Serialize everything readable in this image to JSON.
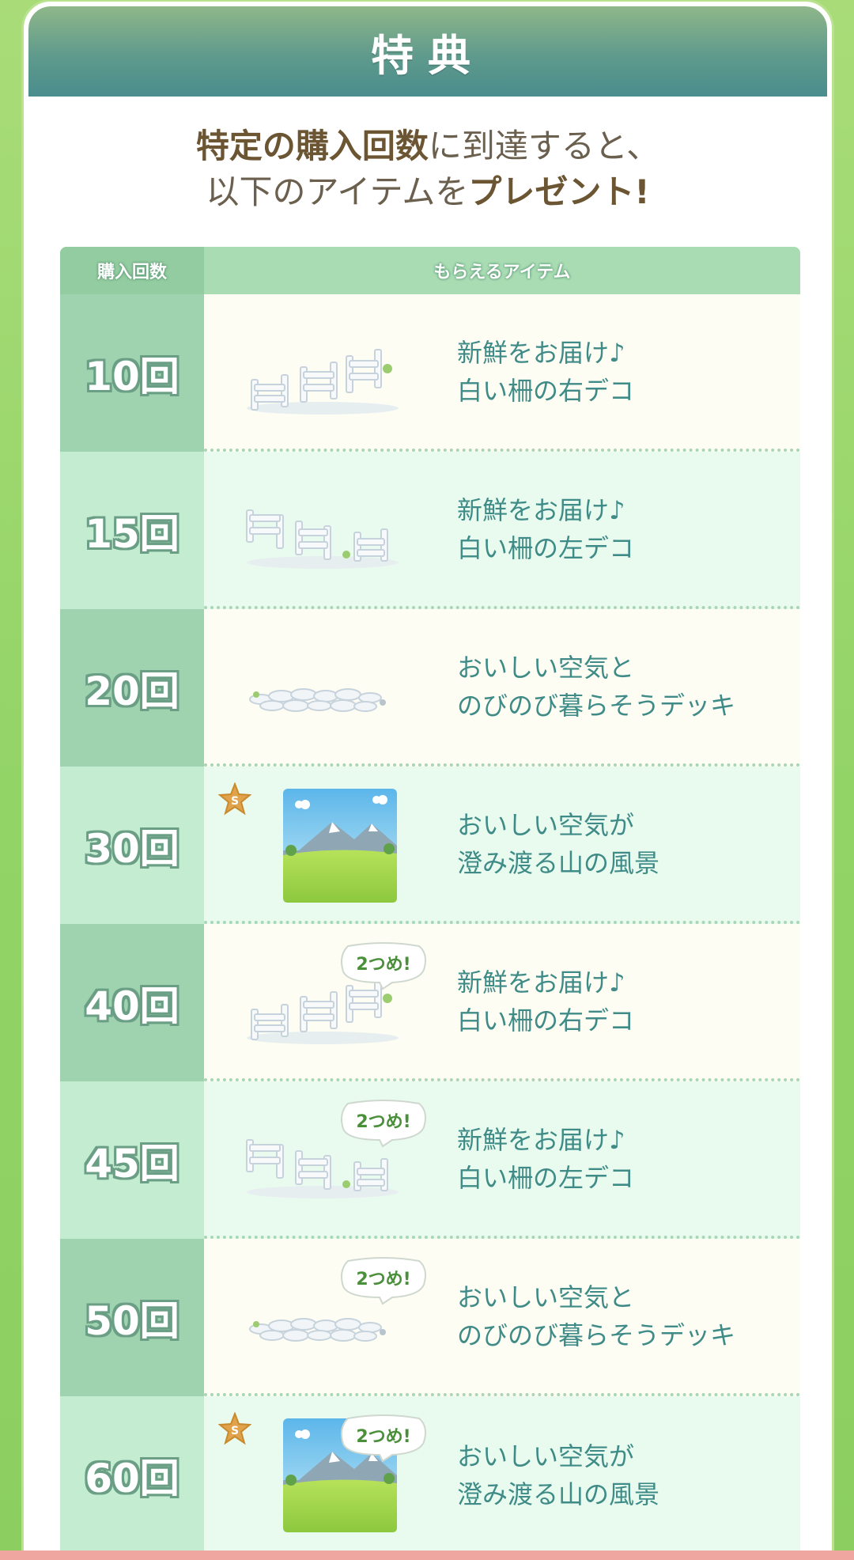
{
  "header": {
    "title": "特典"
  },
  "intro": {
    "line1_bold": "特定の購入回数",
    "line1_rest": "に到達すると、",
    "line2_rest": "以下のアイテムを",
    "line2_bold": "プレゼント!"
  },
  "table": {
    "col_count": "購入回数",
    "col_items": "もらえるアイテム",
    "rows": [
      {
        "count": "10回",
        "line1": "新鮮をお届け♪",
        "line2": "白い柵の右デコ",
        "art": "fence-right-icon",
        "second": false,
        "special": false
      },
      {
        "count": "15回",
        "line1": "新鮮をお届け♪",
        "line2": "白い柵の左デコ",
        "art": "fence-left-icon",
        "second": false,
        "special": false
      },
      {
        "count": "20回",
        "line1": "おいしい空気と",
        "line2": "のびのび暮らそうデッキ",
        "art": "stone-deck-icon",
        "second": false,
        "special": false
      },
      {
        "count": "30回",
        "line1": "おいしい空気が",
        "line2": "澄み渡る山の風景",
        "art": "mountain-landscape-icon",
        "second": false,
        "special": true
      },
      {
        "count": "40回",
        "line1": "新鮮をお届け♪",
        "line2": "白い柵の右デコ",
        "art": "fence-right-icon",
        "second": true,
        "special": false
      },
      {
        "count": "45回",
        "line1": "新鮮をお届け♪",
        "line2": "白い柵の左デコ",
        "art": "fence-left-icon",
        "second": true,
        "special": false
      },
      {
        "count": "50回",
        "line1": "おいしい空気と",
        "line2": "のびのび暮らそうデッキ",
        "art": "stone-deck-icon",
        "second": true,
        "special": false
      },
      {
        "count": "60回",
        "line1": "おいしい空気が",
        "line2": "澄み渡る山の風景",
        "art": "mountain-landscape-icon",
        "second": true,
        "special": true
      }
    ],
    "second_badge_label": "2つめ!",
    "special_badge_label": "S"
  },
  "colors": {
    "header": "#5f9a8c",
    "count_col_dark": "#9fd2ae",
    "count_col_light": "#c3ecd0",
    "item_text": "#3f8b87",
    "background": "#93d467"
  }
}
